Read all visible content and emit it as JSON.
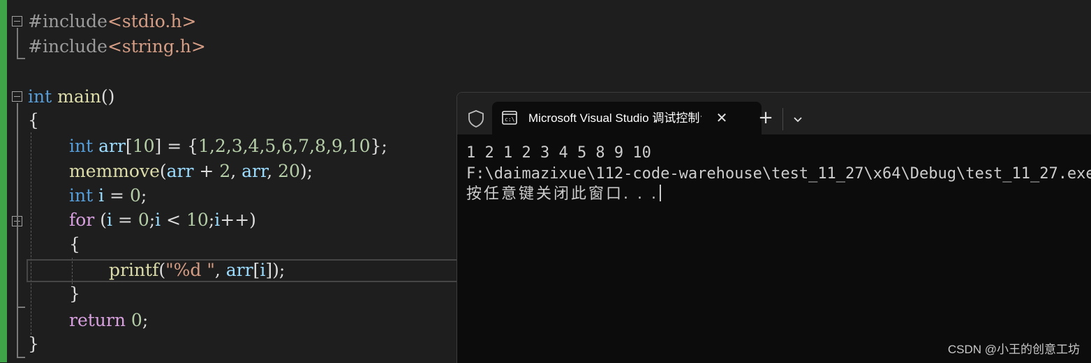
{
  "editor": {
    "lines": {
      "l1_pre": "#include",
      "l1_inc": "<stdio.h>",
      "l2_pre": "#include",
      "l2_inc": "<string.h>",
      "l4_kw": "int",
      "l4_fn": "main",
      "l4_punc": "()",
      "l5": "{",
      "l6_kw": "int",
      "l6_var": "arr",
      "l6_open": "[",
      "l6_num": "10",
      "l6_rest": "] = {",
      "l6_vals": "1,2,3,4,5,6,7,8,9,10",
      "l6_end": "};",
      "l7_fn": "memmove",
      "l7_open": "(",
      "l7_var1": "arr",
      "l7_plus": " + ",
      "l7_num1": "2",
      "l7_comma": ", ",
      "l7_var2": "arr",
      "l7_comma2": ", ",
      "l7_num2": "20",
      "l7_end": ");",
      "l8_kw": "int",
      "l8_var": "i",
      "l8_eq": " = ",
      "l8_num": "0",
      "l8_end": ";",
      "l9_kw": "for",
      "l9_open": " (",
      "l9_var1": "i",
      "l9_eq": " = ",
      "l9_num1": "0",
      "l9_semi": ";",
      "l9_var2": "i",
      "l9_lt": " < ",
      "l9_num2": "10",
      "l9_semi2": ";",
      "l9_var3": "i",
      "l9_inc": "++)",
      "l10": "{",
      "l11_fn": "printf",
      "l11_open": "(",
      "l11_str": "\"%d \"",
      "l11_comma": ", ",
      "l11_var": "arr",
      "l11_br": "[",
      "l11_var2": "i",
      "l11_end": "]);",
      "l12": "}",
      "l13_kw": "return",
      "l13_num": "0",
      "l13_end": ";",
      "l14": "}"
    }
  },
  "terminal": {
    "tab_title": "Microsoft Visual Studio 调试控制台",
    "close_glyph": "✕",
    "new_tab_glyph": "+",
    "output_line1": "1 2 1 2 3 4 5 8 9 10",
    "output_line2": "F:\\daimazixue\\112-code-warehouse\\test_11_27\\x64\\Debug\\test_11_27.exe",
    "output_line3": "按任意键关闭此窗口. . ."
  },
  "watermark": "CSDN @小王的创意工坊",
  "colors": {
    "keyword": "#569cd6",
    "function": "#dcdcaa",
    "variable": "#9cdcfe",
    "number": "#b5cea8",
    "string": "#d69d85",
    "change_bar": "#3fa447"
  }
}
